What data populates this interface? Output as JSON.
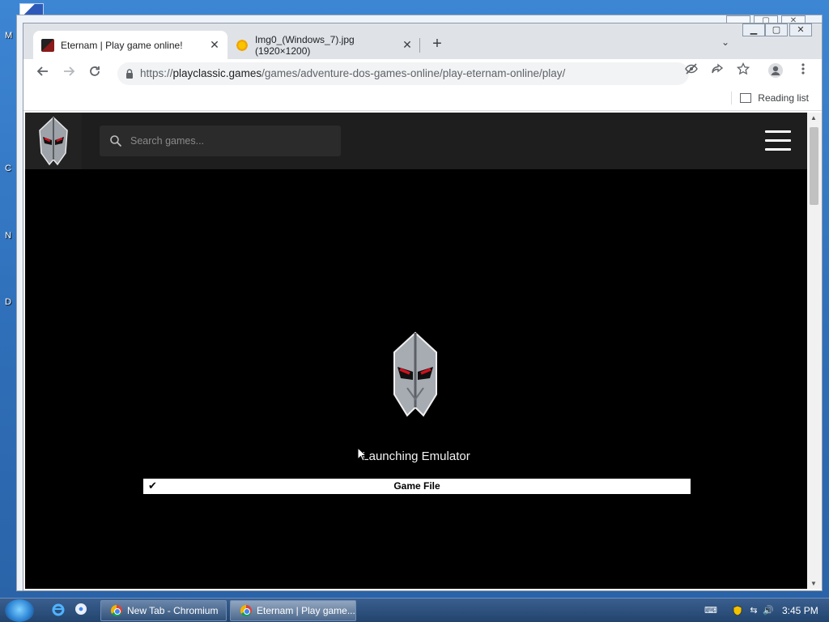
{
  "desktop": {
    "labels": [
      "M",
      "C",
      "N",
      "D"
    ]
  },
  "back_window": {
    "controls": [
      "minimize",
      "maximize",
      "close"
    ]
  },
  "tabs": [
    {
      "title": "Eternam | Play game online!",
      "active": true
    },
    {
      "title": "Img0_(Windows_7).jpg (1920×1200)",
      "active": false
    }
  ],
  "tab_close_glyph": "✕",
  "newtab_glyph": "+",
  "toolbar": {
    "url_prefix": "https://",
    "url_domain": "playclassic.games",
    "url_path": "/games/adventure-dos-games-online/play-eternam-online/play/"
  },
  "bookmarks": {
    "reading_list": "Reading list"
  },
  "site": {
    "search_placeholder": "Search games..."
  },
  "game": {
    "status_text": "Launching Emulator",
    "progress_label": "Game File",
    "progress_check": "✔"
  },
  "taskbar": {
    "tasks": [
      {
        "label": "New Tab - Chromium",
        "active": false
      },
      {
        "label": "Eternam | Play game...",
        "active": true
      }
    ],
    "clock": "3:45 PM"
  },
  "icons": {
    "back": "arrow-left-icon",
    "forward": "arrow-right-icon",
    "reload": "reload-icon",
    "lock": "lock-icon",
    "tracking": "eye-off-icon",
    "share": "share-icon",
    "bookmark": "star-icon",
    "profile": "profile-icon",
    "menu": "kebab-menu-icon"
  },
  "colors": {
    "site_header": "#1e1e1e",
    "game_background": "#000000",
    "progress_bar": "#ffffff",
    "logo_accent": "#c8102e"
  }
}
